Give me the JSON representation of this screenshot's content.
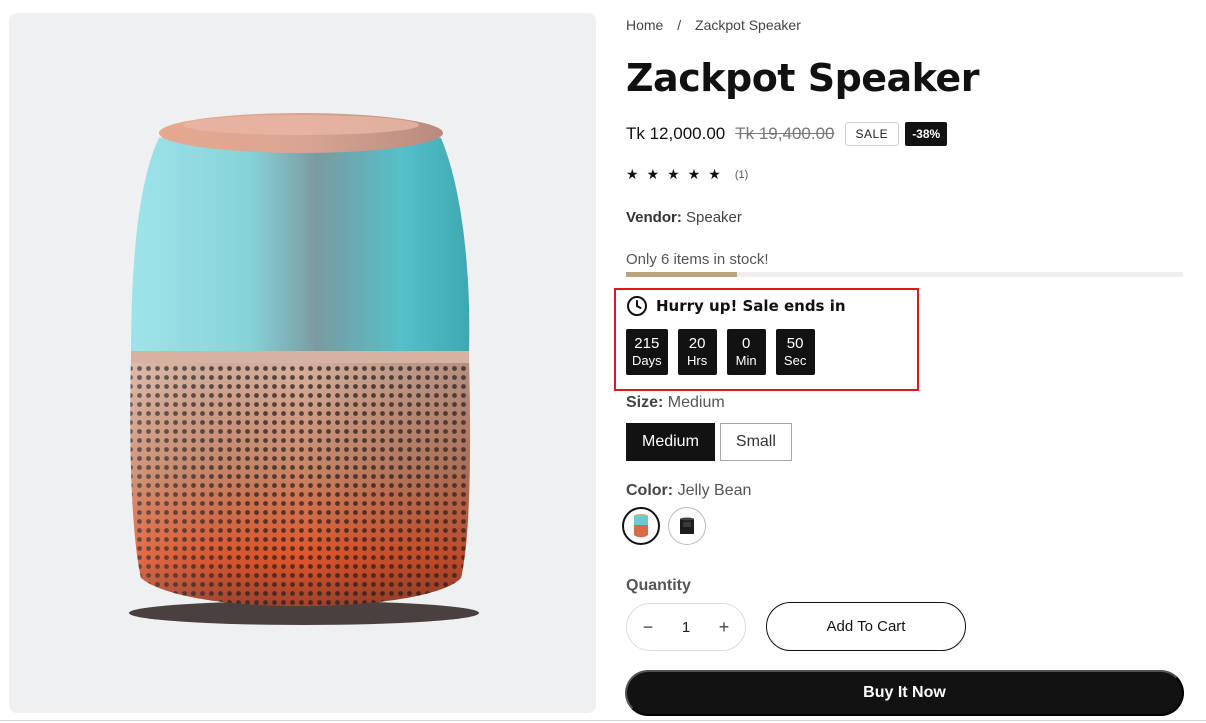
{
  "breadcrumb": {
    "home": "Home",
    "separator": "/",
    "current": "Zackpot Speaker"
  },
  "product": {
    "title": "Zackpot Speaker",
    "price": "Tk 12,000.00",
    "compare_price": "Tk 19,400.00",
    "sale_badge": "SALE",
    "discount_badge": "-38%",
    "rating": {
      "stars": 5,
      "star_glyph": "★",
      "count": "(1)"
    },
    "vendor_label": "Vendor:",
    "vendor": "Speaker",
    "stock_text": "Only 6 items in stock!",
    "stock_fraction": 0.2
  },
  "countdown": {
    "heading": "Hurry up! Sale ends in",
    "icon": "clock-icon",
    "units": [
      {
        "value": "215",
        "label": "Days"
      },
      {
        "value": "20",
        "label": "Hrs"
      },
      {
        "value": "0",
        "label": "Min"
      },
      {
        "value": "50",
        "label": "Sec"
      }
    ],
    "border_color": "#e0161b"
  },
  "size": {
    "label": "Size:",
    "selected": "Medium",
    "options": [
      "Medium",
      "Small"
    ]
  },
  "color": {
    "label": "Color:",
    "selected": "Jelly Bean",
    "swatches": [
      "speaker-jelly-bean-thumb",
      "speaker-black-thumb"
    ]
  },
  "quantity": {
    "label": "Quantity",
    "value": "1",
    "minus": "−",
    "plus": "+"
  },
  "buttons": {
    "add_to_cart": "Add To Cart",
    "buy_now": "Buy It Now"
  },
  "colors": {
    "primary": "#121212",
    "stock_bar": "#b8a57c",
    "gallery_bg": "#eef0f2"
  }
}
